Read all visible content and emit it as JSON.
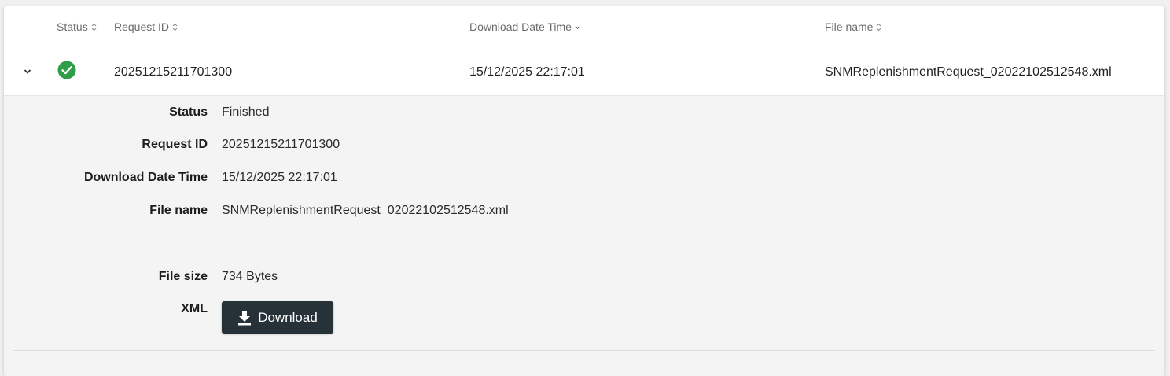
{
  "columns": {
    "status": "Status",
    "request_id": "Request ID",
    "download_date_time": "Download Date Time",
    "file_name": "File name"
  },
  "row": {
    "request_id": "20251215211701300",
    "download_date_time": "15/12/2025 22:17:01",
    "file_name": "SNMReplenishmentRequest_02022102512548.xml",
    "status_icon": "check-circle-icon",
    "status_color": "#2e9e47"
  },
  "details": {
    "status_label": "Status",
    "status_value": "Finished",
    "request_id_label": "Request ID",
    "request_id_value": "20251215211701300",
    "download_date_time_label": "Download Date Time",
    "download_date_time_value": "15/12/2025 22:17:01",
    "file_name_label": "File name",
    "file_name_value": "SNMReplenishmentRequest_02022102512548.xml",
    "file_size_label": "File size",
    "file_size_value": "734 Bytes",
    "xml_label": "XML",
    "download_button": "Download"
  },
  "colors": {
    "button_bg": "#263238",
    "details_bg": "#f4f4f4"
  }
}
